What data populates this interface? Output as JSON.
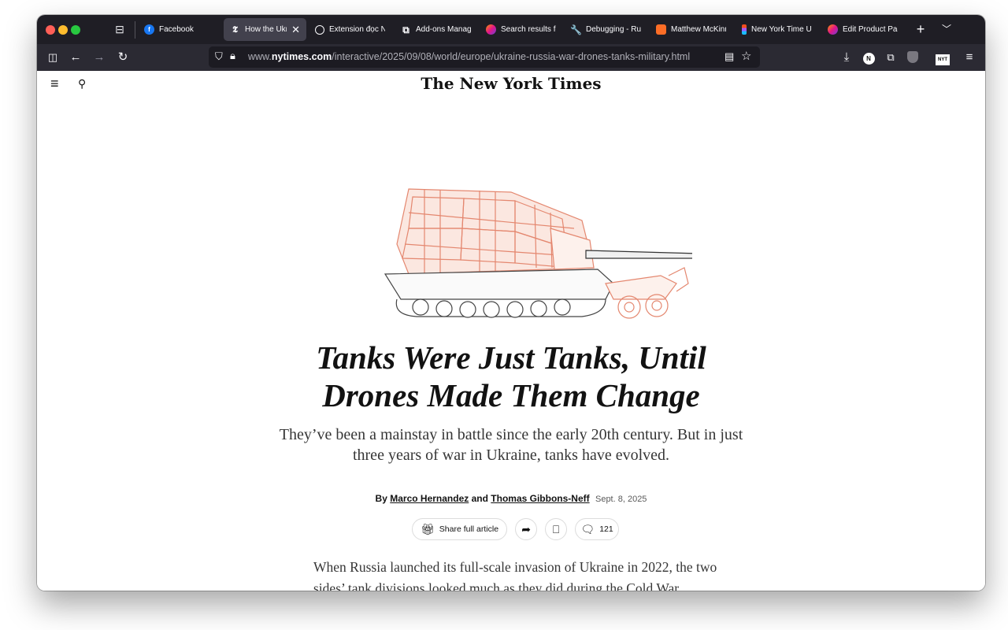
{
  "tabs": [
    {
      "title": "Facebook",
      "icon": "facebook-icon",
      "active": false
    },
    {
      "title": "How the Ukrai",
      "icon": "nyt-t-icon",
      "active": true
    },
    {
      "title": "Extension đọc N",
      "icon": "openai-icon",
      "active": false
    },
    {
      "title": "Add-ons Manage",
      "icon": "puzzle-icon",
      "active": false
    },
    {
      "title": "Search results fo",
      "icon": "firefox-icon",
      "active": false
    },
    {
      "title": "Debugging - Run",
      "icon": "wrench-icon",
      "active": false
    },
    {
      "title": "Matthew McKinn",
      "icon": "gitlab-icon",
      "active": false
    },
    {
      "title": "New York Time U",
      "icon": "figma-icon",
      "active": false
    },
    {
      "title": "Edit Product Pag",
      "icon": "firefox-icon",
      "active": false
    }
  ],
  "url": {
    "prefix": "www.",
    "domain": "nytimes.com",
    "path": "/interactive/2025/09/08/world/europe/ukraine-russia-war-drones-tanks-military.html"
  },
  "toolbar_extensions": {
    "dark_ext": "N",
    "nyt_ext": "NYT"
  },
  "page": {
    "logo": "The New York Times",
    "headline": "Tanks Were Just Tanks, Until Drones Made Them Change",
    "dek": "They’ve been a mainstay in battle since the early 20th century. But in just three years of war in Ukraine, tanks have evolved.",
    "byline_prefix": "By",
    "author1": "Marco Hernandez",
    "byline_and": "and",
    "author2": "Thomas Gibbons-Neff",
    "date": "Sept. 8, 2025",
    "share_label": "Share full article",
    "comment_count": "121",
    "body": "When Russia launched its full-scale invasion of Ukraine in 2022, the two sides’ tank divisions looked much as they did during the Cold War."
  },
  "colors": {
    "accent_hero": "#e4876f",
    "chrome_dark": "#1f1e25",
    "toolbar": "#2b2a33"
  }
}
